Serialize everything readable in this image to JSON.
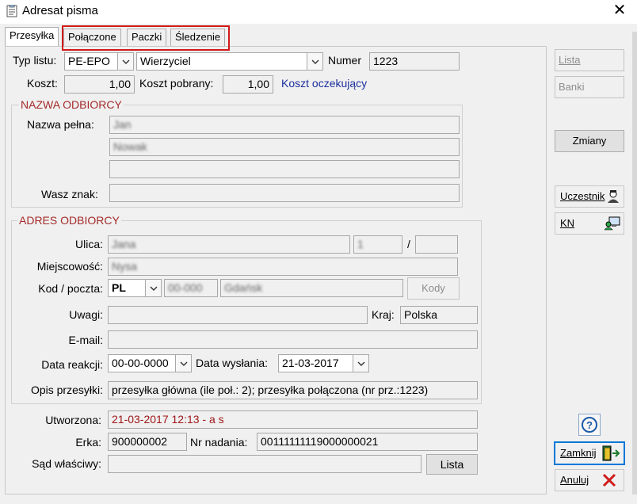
{
  "window": {
    "title": "Adresat pisma"
  },
  "tabs": [
    "Przesyłka",
    "Połączone",
    "Paczki",
    "Śledzenie"
  ],
  "form": {
    "typ_listu_label": "Typ listu:",
    "typ_listu_value": "PE-EPO",
    "recipient_type_value": "Wierzyciel",
    "numer_label": "Numer",
    "numer_value": "1223",
    "koszt_label": "Koszt:",
    "koszt_value": "1,00",
    "koszt_pobrany_label": "Koszt pobrany:",
    "koszt_pobrany_value": "1,00",
    "koszt_oczekujacy": "Koszt oczekujący"
  },
  "nazwa_odbiorcy": {
    "title": "NAZWA ODBIORCY",
    "nazwa_pelna_label": "Nazwa pełna:",
    "line1": "Jan",
    "line2": "Nowak",
    "line3": "",
    "wasz_znak_label": "Wasz znak:",
    "wasz_znak_value": ""
  },
  "adres_odbiorcy": {
    "title": "ADRES ODBIORCY",
    "ulica_label": "Ulica:",
    "ulica_value": "Jana",
    "house_no": "1",
    "slash": "/",
    "flat_no": "",
    "miejscowosc_label": "Miejscowość:",
    "miejscowosc_value": "Nysa",
    "kod_label": "Kod / poczta:",
    "country_code": "PL",
    "postal_code": "00-000",
    "post_office": "Gdańsk",
    "kody_button": "Kody",
    "uwagi_label": "Uwagi:",
    "uwagi_value": "",
    "kraj_label": "Kraj:",
    "kraj_value": "Polska",
    "email_label": "E-mail:",
    "email_value": "",
    "data_reakcji_label": "Data reakcji:",
    "data_reakcji_value": "00-00-0000",
    "data_wyslania_label": "Data wysłania:",
    "data_wyslania_value": "21-03-2017",
    "opis_label": "Opis przesyłki:",
    "opis_value": "przesyłka główna (ile poł.: 2); przesyłka połączona (nr prz.:1223)"
  },
  "bottom": {
    "utworzona_label": "Utworzona:",
    "utworzona_value": "21-03-2017 12:13 -  a s",
    "erka_label": "Erka:",
    "erka_value": "900000002",
    "nr_nadania_label": "Nr nadania:",
    "nr_nadania_value": "00111111119000000021",
    "sad_label": "Sąd właściwy:",
    "sad_value": "",
    "lista_button": "Lista"
  },
  "sidebar": {
    "lista_button": "Lista",
    "banki_button": "Banki",
    "zmiany_button": "Zmiany",
    "uczestnik_button": "Uczestnik",
    "kn_button": "KN",
    "help_icon": "?",
    "zamknij_button": "Zamknij",
    "anuluj_button": "Anuluj"
  },
  "colors": {
    "accent_red": "#a52a2a",
    "link_blue": "#1c2f9e",
    "highlight": "#d11a1a",
    "focus": "#0078d7"
  }
}
